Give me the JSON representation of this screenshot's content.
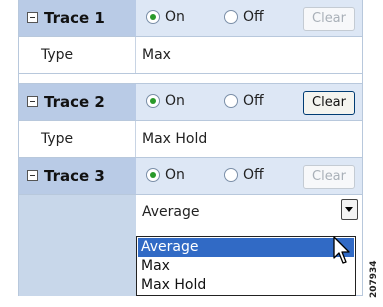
{
  "traces": [
    {
      "title": "Trace 1",
      "on_label": "On",
      "off_label": "Off",
      "selected": "On",
      "clear_label": "Clear",
      "clear_enabled": false,
      "type_label": "Type",
      "type_value": "Max"
    },
    {
      "title": "Trace 2",
      "on_label": "On",
      "off_label": "Off",
      "selected": "On",
      "clear_label": "Clear",
      "clear_enabled": true,
      "type_label": "Type",
      "type_value": "Max Hold"
    },
    {
      "title": "Trace 3",
      "on_label": "On",
      "off_label": "Off",
      "selected": "On",
      "clear_label": "Clear",
      "clear_enabled": false
    }
  ],
  "combo": {
    "value": "Average"
  },
  "dropdown": {
    "options": [
      "Average",
      "Max",
      "Max Hold"
    ],
    "highlighted": "Average"
  },
  "figure_id": "207934",
  "colors": {
    "header_bg": "#b9cbe6",
    "header_right_bg": "#dde7f5",
    "radio_dot": "#2a9a2a",
    "selection": "#316ac5"
  }
}
